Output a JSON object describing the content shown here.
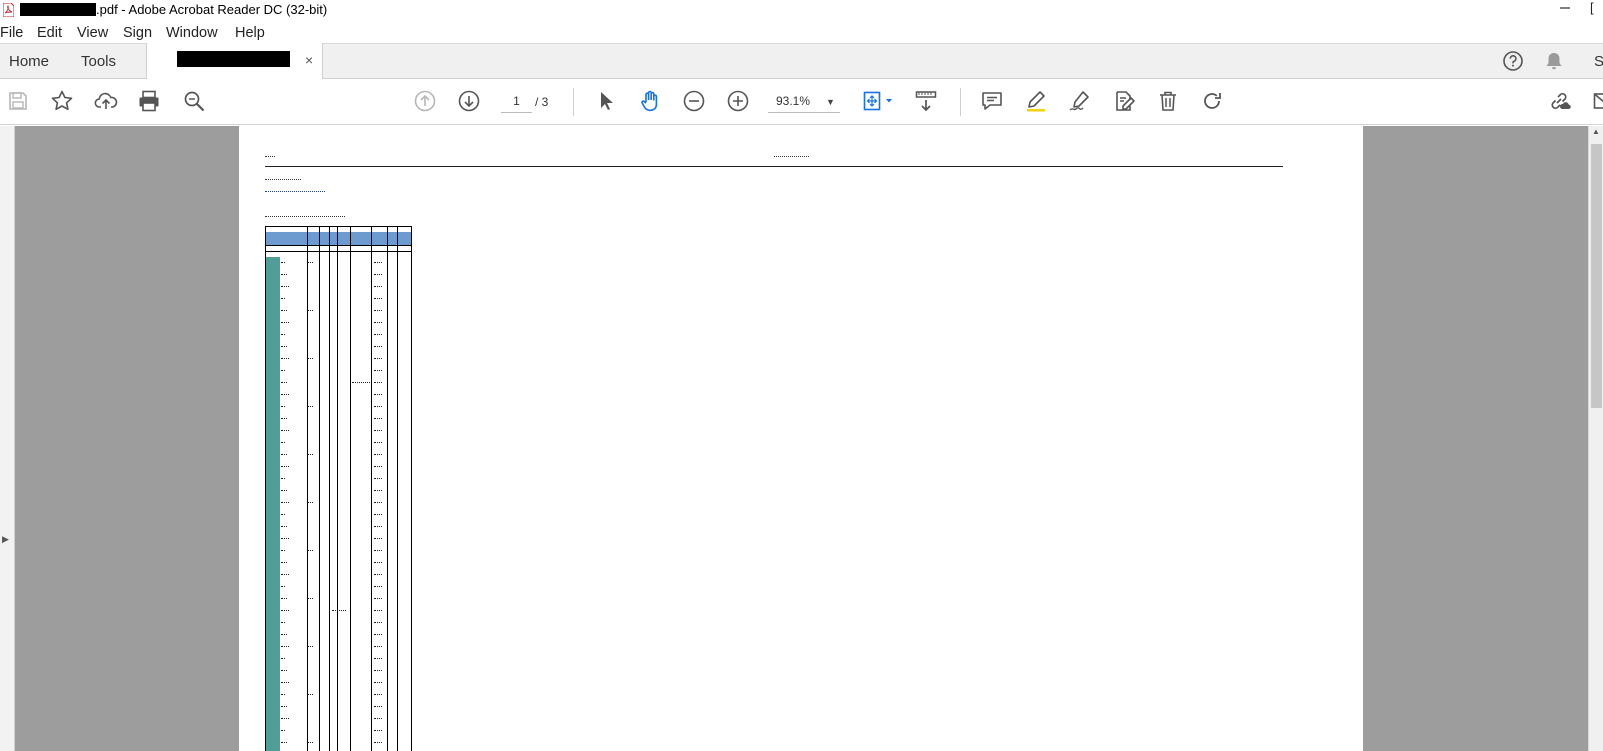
{
  "window": {
    "title_suffix": ".pdf - Adobe Acrobat Reader DC (32-bit)",
    "right_edge_char": "["
  },
  "menu": {
    "items": [
      "File",
      "Edit",
      "View",
      "Sign",
      "Window",
      "Help"
    ]
  },
  "tabs": {
    "home": "Home",
    "tools": "Tools",
    "document_close": "×",
    "right_edge_char": "S"
  },
  "toolbar": {
    "page_current": "1",
    "page_total": "/ 3",
    "zoom": "93.1%",
    "zoom_caret": "▼"
  },
  "icons": {
    "window": [
      "pdf-file-icon",
      "minimize-icon"
    ],
    "tabrow": [
      "help-icon",
      "notifications-icon"
    ],
    "toolbar": [
      "save-icon",
      "bookmark-star-icon",
      "upload-cloud-icon",
      "print-icon",
      "find-icon",
      "previous-page-icon",
      "next-page-icon",
      "select-cursor-icon",
      "hand-tool-icon",
      "zoom-out-icon",
      "zoom-in-icon",
      "fit-page-icon",
      "scroll-mode-icon",
      "comment-icon",
      "highlight-icon",
      "sign-icon",
      "edit-pdf-icon",
      "delete-icon",
      "rotate-icon",
      "share-link-icon",
      "email-icon"
    ]
  },
  "colors": {
    "acrobat_blue": "#1473e6",
    "table_header_fill": "#6d9bd0",
    "table_first_column_fill": "#4f9e98",
    "document_background": "#9d9d9d"
  }
}
